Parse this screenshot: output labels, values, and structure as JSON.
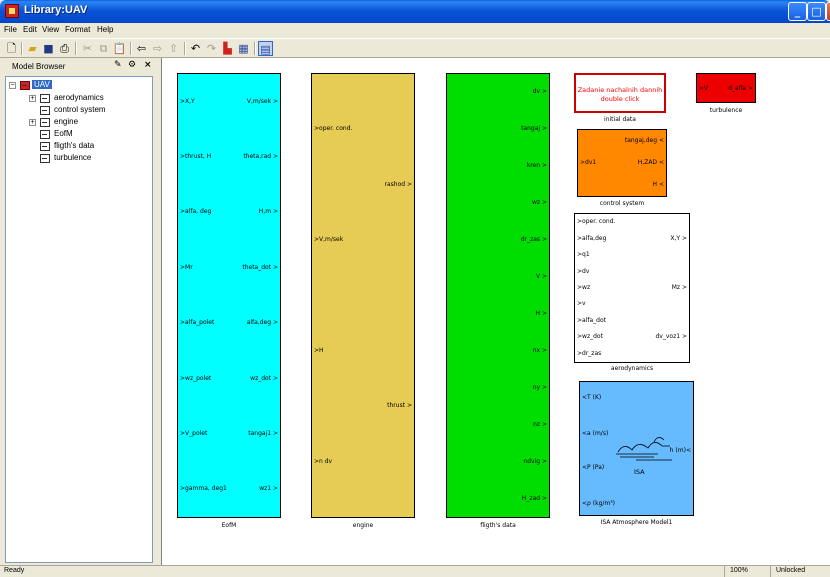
{
  "window": {
    "title": "Library:UAV"
  },
  "menu": [
    "File",
    "Edit",
    "View",
    "Format",
    "Help"
  ],
  "toolbar": [
    "new-icon",
    "open-icon",
    "save-icon",
    "print-icon",
    "cut-icon",
    "copy-icon",
    "paste-icon",
    "back-icon",
    "forward-icon",
    "up-icon",
    "undo-icon",
    "redo-icon",
    "library-icon",
    "model-explorer-icon",
    "model-browser-icon"
  ],
  "model_browser": {
    "title": "Model Browser",
    "tree": [
      {
        "label": "UAV",
        "selected": true,
        "expander": "−"
      },
      {
        "label": "aerodynamics",
        "expander": "+"
      },
      {
        "label": "control system",
        "expander": ""
      },
      {
        "label": "engine",
        "expander": "+"
      },
      {
        "label": "EofM",
        "expander": ""
      },
      {
        "label": "fligth's data",
        "expander": ""
      },
      {
        "label": "turbulence",
        "expander": ""
      }
    ]
  },
  "blocks": {
    "eofm": {
      "name": "EofM",
      "color": "#00ffff",
      "inputs": [
        "X,Y",
        "thrust, H",
        "alfa, deg",
        "Mr",
        "alfa_polet",
        "wz_polet",
        "V_polet",
        "gamma, deg1"
      ],
      "outputs": [
        "V,m/sek",
        "theta,rad",
        "H,m",
        "theta_dot",
        "alfa,deg",
        "wz_dot",
        "tangaj1",
        "wz1"
      ]
    },
    "engine": {
      "name": "engine",
      "color": "#e6cc55",
      "inputs": [
        "oper. cond.",
        "V,m/sek",
        "H",
        "n dv"
      ],
      "outputs": [
        "rashod",
        "thrust"
      ]
    },
    "flight_data": {
      "name": "fligth's data",
      "color": "#00dd00",
      "outputs": [
        "dv",
        "tangaj",
        "kren",
        "wz",
        "dr_zas",
        "V",
        "H",
        "nx",
        "ny",
        "nz",
        "ndvig",
        "H_zad"
      ]
    },
    "initial_data": {
      "name": "initial data",
      "text_line1": "Zadanie nachalnih dannih",
      "text_line2": "double click",
      "text_color": "#ff0000"
    },
    "turbulence": {
      "name": "turbulence",
      "color": "#ee0000",
      "input": "V",
      "output": "d_alfa"
    },
    "control_system": {
      "name": "control system",
      "color": "#ff8800",
      "inputs": [
        "dv1"
      ],
      "outputs": [
        "tangaj,deg",
        "H,ZAD",
        "H"
      ]
    },
    "aerodynamics": {
      "name": "aerodynamics",
      "color": "#ffffff",
      "inputs": [
        "oper. cond.",
        "alfa,deg",
        "q1",
        "dv",
        "wz",
        "v",
        "alfa_dot",
        "wz_dot",
        "dr_zas"
      ],
      "outputs": [
        "X,Y",
        "Mz",
        "dv_voz1"
      ]
    },
    "isa": {
      "name": "ISA Atmosphere Model1",
      "color": "#66bbff",
      "center_label": "ISA",
      "outputs_left": [
        "T (K)",
        "a (m/s)",
        "P (Pa)",
        "ρ (kg/m³)"
      ],
      "input_right": "h (m)"
    }
  },
  "status": {
    "left": "Ready",
    "zoom": "100%",
    "lock": "Unlocked"
  }
}
